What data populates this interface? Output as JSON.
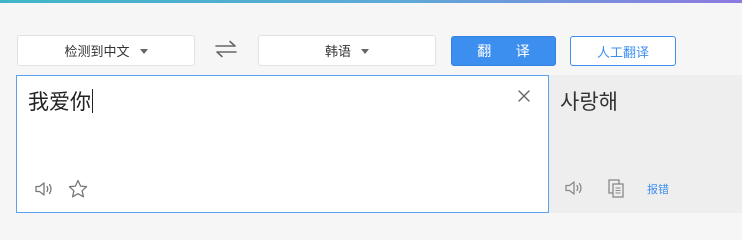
{
  "source_lang": {
    "label": "检测到中文"
  },
  "target_lang": {
    "label": "韩语"
  },
  "buttons": {
    "translate": "翻 译",
    "human_translate": "人工翻译"
  },
  "input": {
    "text": "我爱你"
  },
  "output": {
    "text": "사랑해",
    "report_label": "报错"
  },
  "icons": {
    "swap": "swap-arrows-icon",
    "clear": "close-icon",
    "speaker": "speaker-icon",
    "favorite": "star-icon",
    "copy": "copy-icon"
  },
  "colors": {
    "accent": "#3d8fef",
    "input_border": "#5aa2ef",
    "output_bg": "#eeeeee"
  }
}
